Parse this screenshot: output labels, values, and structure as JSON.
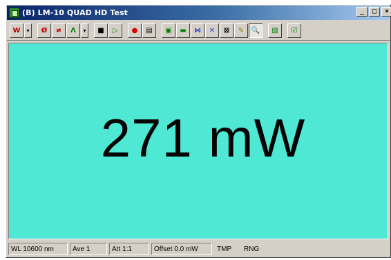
{
  "window": {
    "title": "(B) LM-10 QUAD HD Test",
    "controls": {
      "minimize": "_",
      "restore": "□",
      "close": "×"
    }
  },
  "toolbar": {
    "buttons": [
      {
        "name": "w-menu",
        "label": "W",
        "color": "#c00000",
        "dropdown": true
      },
      {
        "name": "no-zero",
        "label": "Ø",
        "color": "#c00000"
      },
      {
        "name": "cancel",
        "label": "≠",
        "color": "#c00000"
      },
      {
        "name": "peak",
        "label": "Λ",
        "color": "#008000",
        "dropdown": true
      },
      {
        "name": "stop",
        "label": "■",
        "color": "#000000"
      },
      {
        "name": "play",
        "label": "▷",
        "color": "#008000"
      },
      {
        "name": "record",
        "label": "●",
        "color": "#e00000"
      },
      {
        "name": "print",
        "label": "▤",
        "color": "#000000"
      },
      {
        "name": "digital-view",
        "label": "▣",
        "color": "#008000"
      },
      {
        "name": "bar-view",
        "label": "▬",
        "color": "#008000"
      },
      {
        "name": "graph-view",
        "label": "⋈",
        "color": "#3040c0"
      },
      {
        "name": "xy-view",
        "label": "✕",
        "color": "#3040c0"
      },
      {
        "name": "zoom-fit",
        "label": "⊠",
        "color": "#000000"
      },
      {
        "name": "pencil",
        "label": "✎",
        "color": "#808000"
      },
      {
        "name": "magnify",
        "label": "🔍",
        "color": "#000000",
        "pressed": true
      },
      {
        "name": "settings",
        "label": "▧",
        "color": "#008000"
      },
      {
        "name": "confirm",
        "label": "☑",
        "color": "#008000"
      }
    ]
  },
  "display": {
    "reading": "271 mW",
    "background": "#4ee8d4"
  },
  "statusbar": {
    "wavelength": "WL 10600 nm",
    "average": "Ave 1",
    "attenuation": "Att 1:1",
    "offset": "Offset 0.0 mW",
    "tmp": "TMP",
    "rng": "RNG"
  }
}
